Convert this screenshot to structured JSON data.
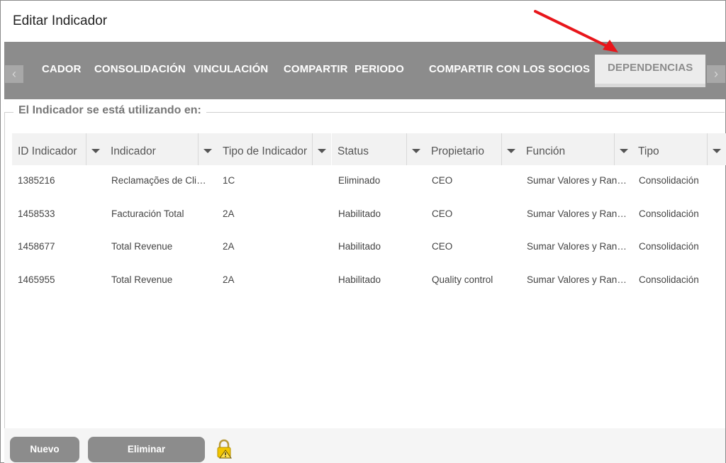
{
  "dialog": {
    "title": "Editar Indicador"
  },
  "tabs": [
    {
      "label": "CADOR"
    },
    {
      "label": "CONSOLIDACIÓN"
    },
    {
      "label": "VINCULACIÓN"
    },
    {
      "label": "COMPARTIR"
    },
    {
      "label": "PERIODO"
    },
    {
      "label": "COMPARTIR CON LOS SOCIOS"
    },
    {
      "label": "DEPENDENCIAS",
      "active": true
    }
  ],
  "nav": {
    "prev_icon": "chevron-left-icon",
    "next_icon": "chevron-right-icon",
    "prev_glyph": "‹",
    "next_glyph": "›"
  },
  "section": {
    "legend": "El Indicador se está utilizando en:"
  },
  "grid": {
    "columns": [
      {
        "label": "ID Indicador"
      },
      {
        "label": "Indicador"
      },
      {
        "label": "Tipo de Indicador"
      },
      {
        "label": "Status"
      },
      {
        "label": "Propietario"
      },
      {
        "label": "Función"
      },
      {
        "label": "Tipo"
      }
    ],
    "rows": [
      [
        "1385216",
        "Reclamações de Clientes",
        "1C",
        "Eliminado",
        "CEO",
        "Sumar Valores y Rangos",
        "Consolidación"
      ],
      [
        "1458533",
        "Facturación Total",
        "2A",
        "Habilitado",
        "CEO",
        "Sumar Valores y Rangos",
        "Consolidación"
      ],
      [
        "1458677",
        "Total Revenue",
        "2A",
        "Habilitado",
        "CEO",
        "Sumar Valores y Rangos",
        "Consolidación"
      ],
      [
        "1465955",
        "Total Revenue",
        "2A",
        "Habilitado",
        "Quality control",
        "Sumar Valores y Rangos",
        "Consolidación"
      ]
    ]
  },
  "footer": {
    "new_label": "Nuevo",
    "delete_label": "Eliminar",
    "lock_icon": "lock-warning-icon"
  },
  "colors": {
    "tabbar": "#8c8c8c",
    "button": "#8c8c8c",
    "annotation_arrow": "#e8161b",
    "lock": "#f2c500"
  }
}
